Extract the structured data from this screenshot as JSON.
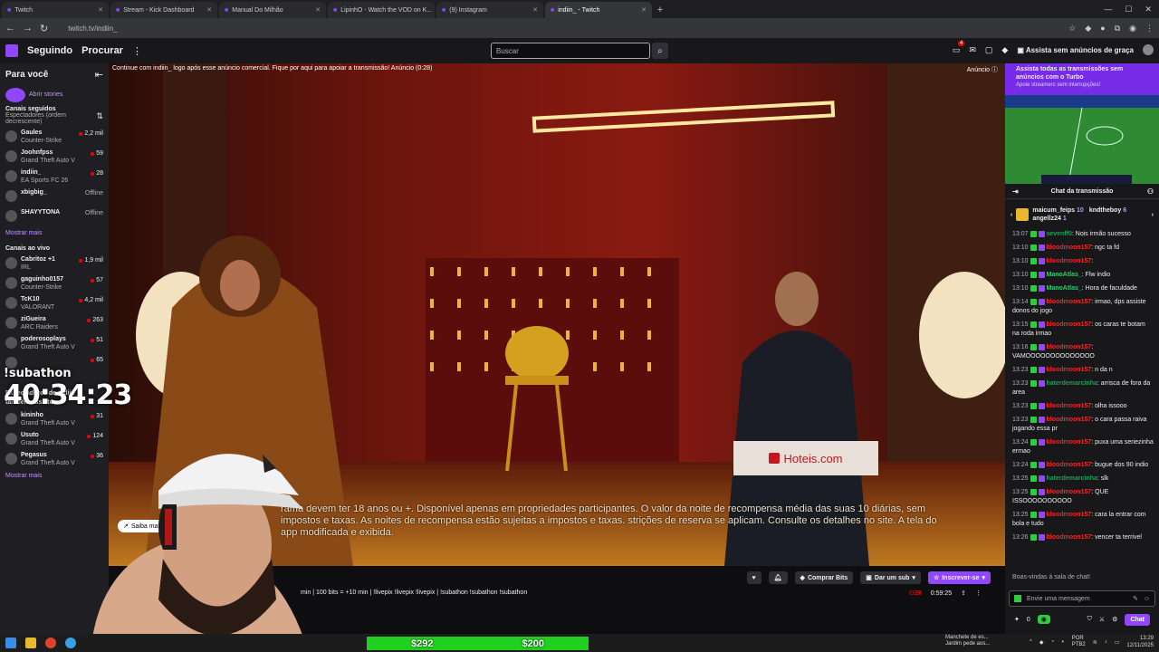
{
  "browser": {
    "tabs": [
      {
        "label": "Twitch",
        "active": false
      },
      {
        "label": "Stream - Kick Dashboard",
        "active": false
      },
      {
        "label": "Manual Do Milhão",
        "active": false
      },
      {
        "label": "LipinhO - Watch the VOD on K...",
        "active": false
      },
      {
        "label": "(9) Instagram",
        "active": false
      },
      {
        "label": "indiin_ - Twitch",
        "active": true
      }
    ],
    "url": "twitch.tv/indiin_"
  },
  "nav": {
    "following": "Seguindo",
    "browse": "Procurar",
    "search_placeholder": "Buscar",
    "turbo": "Assista sem anúncios de graça",
    "notif_count": "4"
  },
  "sidebar": {
    "for_you": "Para você",
    "stories": "Abrir stories",
    "followed_title": "Canais seguidos",
    "followed_sort": "Espectadores (ordem decrescente)",
    "followed": [
      {
        "name": "Gaules",
        "game": "Counter-Strike",
        "viewers": "2,2 mil"
      },
      {
        "name": "Joohnfpss",
        "game": "Grand Theft Auto V",
        "viewers": "59"
      },
      {
        "name": "indiin_",
        "game": "EA Sports FC 26",
        "viewers": "28"
      },
      {
        "name": "xbigbig_",
        "game": "",
        "viewers": "Offline"
      },
      {
        "name": "SHAYYTONA",
        "game": "",
        "viewers": "Offline"
      }
    ],
    "show_more": "Mostrar mais",
    "live_title": "Canais ao vivo",
    "live": [
      {
        "name": "Cabritoz +1",
        "game": "IRL",
        "viewers": "1,9 mil"
      },
      {
        "name": "gaguinho0157",
        "game": "Counter-Strike",
        "viewers": "57"
      },
      {
        "name": "TcK10",
        "game": "VALORANT",
        "viewers": "4,2 mil"
      },
      {
        "name": "ziGueira",
        "game": "ARC Raiders",
        "viewers": "263"
      },
      {
        "name": "poderosoplays",
        "game": "Grand Theft Auto V",
        "viewers": "51"
      }
    ],
    "partial_row_viewers": "65",
    "also_title": "Espectadores de indiin_ também assistem",
    "also": [
      {
        "name": "kininho",
        "game": "Grand Theft Auto V",
        "viewers": "31"
      },
      {
        "name": "Usuto",
        "game": "Grand Theft Auto V",
        "viewers": "124"
      },
      {
        "name": "Pegasus",
        "game": "Grand Theft Auto V",
        "viewers": "36"
      }
    ],
    "show_more2": "Mostrar mais"
  },
  "player": {
    "ad_banner": "Continue com indiin_ logo após esse anúncio comercial. Fique por aqui para apoiar a transmissão! Anúncio (0:28)",
    "ad_label": "Anúncio",
    "subtitle": "rama devem ter 18 anos ou +. Disponível apenas em propriedades participantes. O valor da noite de recompensa média das suas 10 diárias, sem impostos e taxas. As noites de recompensa estão sujeitas a impostos e taxas. strições de reserva se aplicam. Consulte os detalhes no site. A tela do app modificada e exibida.",
    "learn_more": "Saiba mais",
    "brand": "Hoteis.com"
  },
  "overlay": {
    "timer_label": "!subathon",
    "timer": "40:34:23"
  },
  "info": {
    "stream_title": "min | 100 bits = +10 min | !livepix !livepix !livepix | !subathon !subathon !subathon",
    "bits": "Comprar Bits",
    "gift": "Dar um sub",
    "subscribe": "Inscrever-se",
    "viewers": "28",
    "uptime": "0:59:25"
  },
  "chat": {
    "turbo_title": "Assista todas as transmissões sem anúncios com o Turbo",
    "turbo_sub": "Apoie streamers sem interrupções!",
    "header": "Chat da transmissão",
    "gifters": [
      {
        "name": "maicum_feips",
        "count": "10"
      },
      {
        "name": "kndtheboy",
        "count": "6"
      },
      {
        "name": "angellz24",
        "count": "1"
      }
    ],
    "messages": [
      {
        "time": "13:07",
        "user": "sevenff0",
        "color": "#1e9e5a",
        "text": "Nois irmão sucesso"
      },
      {
        "time": "13:10",
        "user": "bloodmoon157",
        "color": "#ff2020",
        "text": "ngc ta fd"
      },
      {
        "time": "13:10",
        "user": "bloodmoon157",
        "color": "#ff2020",
        "text": ""
      },
      {
        "time": "13:10",
        "user": "ManoAtlas_",
        "color": "#2ecc71",
        "text": "Flw indio"
      },
      {
        "time": "13:10",
        "user": "ManoAtlas_",
        "color": "#2ecc71",
        "text": "Hora de faculdade"
      },
      {
        "time": "13:14",
        "user": "bloodmoon157",
        "color": "#ff2020",
        "text": "irmao, dps assiste donos do jogo"
      },
      {
        "time": "13:15",
        "user": "bloodmoon157",
        "color": "#ff2020",
        "text": "os caras te botam na roda irmao"
      },
      {
        "time": "13:16",
        "user": "bloodmoon157",
        "color": "#ff2020",
        "text": "VAMOOOOOOOOOOOOOO"
      },
      {
        "time": "13:23",
        "user": "bloodmoon157",
        "color": "#ff2020",
        "text": "n da n"
      },
      {
        "time": "13:23",
        "user": "haterdemarcinha",
        "color": "#1e9e5a",
        "text": "arrisca de fora da area"
      },
      {
        "time": "13:23",
        "user": "bloodmoon157",
        "color": "#ff2020",
        "text": "olha issooo"
      },
      {
        "time": "13:23",
        "user": "bloodmoon157",
        "color": "#ff2020",
        "text": "o cara passa raiva jogando essa pr"
      },
      {
        "time": "13:24",
        "user": "bloodmoon157",
        "color": "#ff2020",
        "text": "puxa uma seriezinha ermao"
      },
      {
        "time": "13:24",
        "user": "bloodmoon157",
        "color": "#ff2020",
        "text": "bugue dos 90 indio"
      },
      {
        "time": "13:25",
        "user": "haterdemarcinha",
        "color": "#1e9e5a",
        "text": "slk"
      },
      {
        "time": "13:25",
        "user": "bloodmoon157",
        "color": "#ff2020",
        "text": "QUE ISSOOOOOOOOOO"
      },
      {
        "time": "13:25",
        "user": "bloodmoon157",
        "color": "#ff2020",
        "text": "cara la entrar com bola e tudo"
      },
      {
        "time": "13:26",
        "user": "bloodmoon157",
        "color": "#ff2020",
        "text": "vencer ta terrivel"
      }
    ],
    "welcome": "Boas-vindas à sala de chat!",
    "input_placeholder": "Envie uma mensagem",
    "points": "0",
    "send": "Chat"
  },
  "taskbar": {
    "goal_left": "$292",
    "goal_right": "$200",
    "news_title": "Manchete de es...",
    "news_sub": "Jardim pede aos...",
    "lang": "POR",
    "layout": "PTB2",
    "time": "13:29",
    "date": "12/11/2025"
  }
}
